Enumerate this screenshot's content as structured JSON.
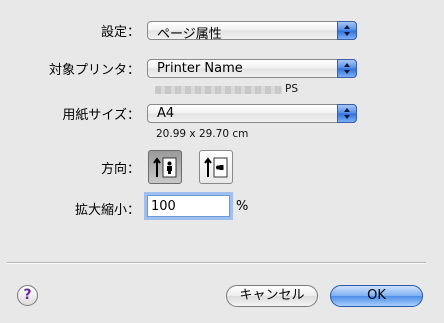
{
  "settings": {
    "label": "設定：",
    "value": "ページ属性"
  },
  "printer": {
    "label": "対象プリンタ：",
    "value": "Printer Name",
    "sub_suffix": "PS"
  },
  "paper": {
    "label": "用紙サイズ：",
    "value": "A4",
    "dimensions": "20.99 x 29.70 cm"
  },
  "orientation": {
    "label": "方向：",
    "options": [
      "portrait-icon",
      "landscape-icon"
    ],
    "selected": 0
  },
  "scale": {
    "label": "拡大縮小：",
    "value": "100",
    "unit": "%"
  },
  "buttons": {
    "help": "?",
    "cancel": "キャンセル",
    "ok": "OK"
  },
  "colors": {
    "accent": "#4e8ee8",
    "focus_ring": "#9fc0ee",
    "background": "#e8e8e8"
  }
}
